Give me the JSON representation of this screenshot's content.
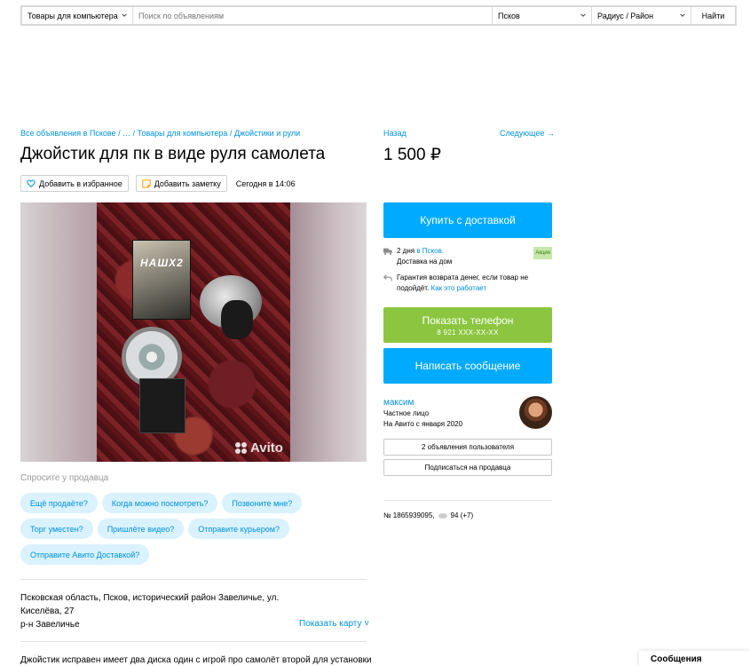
{
  "search": {
    "category": "Товары для компьютера",
    "placeholder": "Поиск по объявлениям",
    "city": "Псков",
    "radius": "Радиус / Район",
    "find_label": "Найти"
  },
  "breadcrumbs": {
    "part1": "Все объявления в Пскове",
    "part2": "…",
    "part3": "Товары для компьютера",
    "part4": "Джойстики и рули",
    "separator": "/"
  },
  "nav": {
    "back": "Назад",
    "next": "Следующее →"
  },
  "listing": {
    "title": "Джойстик для пк в виде руля самолета",
    "price": "1 500 ₽",
    "add_favorite": "Добавить в избранное",
    "add_note": "Добавить заметку",
    "date": "Сегодня в 14:06"
  },
  "gallery": {
    "box_label": "НАШХ2",
    "watermark": "Avito"
  },
  "ask": {
    "title": "Спросите у продавца",
    "chips": [
      "Ещё продаёте?",
      "Когда можно посмотреть?",
      "Позвоните мне?",
      "Торг уместен?",
      "Пришлёте видео?",
      "Отправите курьером?",
      "Отправите Авито Доставкой?"
    ]
  },
  "address": {
    "line1": "Псковская область, Псков, исторический район Завеличье, ул.",
    "line2": "Киселёва, 27",
    "line3": "р-н Завеличье",
    "map_link": "Показать карту ˅"
  },
  "description": "Джойстик исправен имеет два диска один с игрой про самолёт второй для установки",
  "buy": {
    "label": "Купить с доставкой",
    "delivery_days": "2 дня",
    "delivery_where": "в Псков.",
    "delivery_home": "Доставка на дом",
    "badge": "Акция",
    "guarantee": "Гарантия возврата денег, если товар не подойдёт.",
    "how_it_works": "Как это работает"
  },
  "phone": {
    "label": "Показать телефон",
    "number": "8 921 XXX-XX-XX"
  },
  "message_label": "Написать сообщение",
  "seller": {
    "name": "максим",
    "type": "Частное лицо",
    "since": "На Авито с января 2020",
    "ads_button": "2 объявления пользователя",
    "subscribe_button": "Подписаться на продавца"
  },
  "stats": {
    "id": "№ 1865939095,",
    "views": "94 (+7)"
  },
  "messages_tab": "Сообщения",
  "colors": {
    "accent": "#00aaff",
    "link": "#0091d9",
    "green": "#8cc640",
    "chip_bg": "#d9f2fd"
  }
}
